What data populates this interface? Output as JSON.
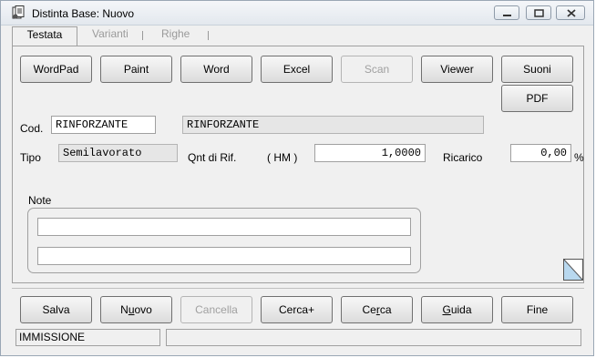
{
  "window": {
    "title": "Distinta Base: Nuovo",
    "icon": "document-gear-icon"
  },
  "tabs": [
    {
      "label": "Testata",
      "active": true
    },
    {
      "label": "Varianti",
      "active": false
    },
    {
      "label": "Righe",
      "active": false
    }
  ],
  "toolbar": {
    "wordpad": "WordPad",
    "paint": "Paint",
    "word": "Word",
    "excel": "Excel",
    "scan": "Scan",
    "viewer": "Viewer",
    "suoni": "Suoni",
    "pdf": "PDF"
  },
  "form": {
    "cod_label": "Cod.",
    "cod_value": "RINFORZANTE",
    "description_value": "RINFORZANTE",
    "tipo_label": "Tipo",
    "tipo_value": "Semilavorato",
    "qnt_label": "Qnt di Rif.",
    "unit": "( HM )",
    "qnt_value": "1,0000",
    "ricarico_label": "Ricarico",
    "ricarico_value": "0,00",
    "percent": "%",
    "note_label": "Note",
    "note_line1": "",
    "note_line2": ""
  },
  "actions": {
    "salva": "Salva",
    "nuovo_pre": "N",
    "nuovo_u": "u",
    "nuovo_post": "ovo",
    "cancella": "Cancella",
    "cercaplus": "Cerca+",
    "cerca_pre": "Ce",
    "cerca_u": "r",
    "cerca_post": "ca",
    "guida_u": "G",
    "guida_post": "uida",
    "fine": "Fine"
  },
  "status": {
    "mode": "IMMISSIONE",
    "message": ""
  },
  "colors": {
    "window_bg": "#f0f0f0",
    "field_gray": "#e6e6e6",
    "disabled_text": "#a0a0a0",
    "corner_fill": "#b8d8ef"
  }
}
